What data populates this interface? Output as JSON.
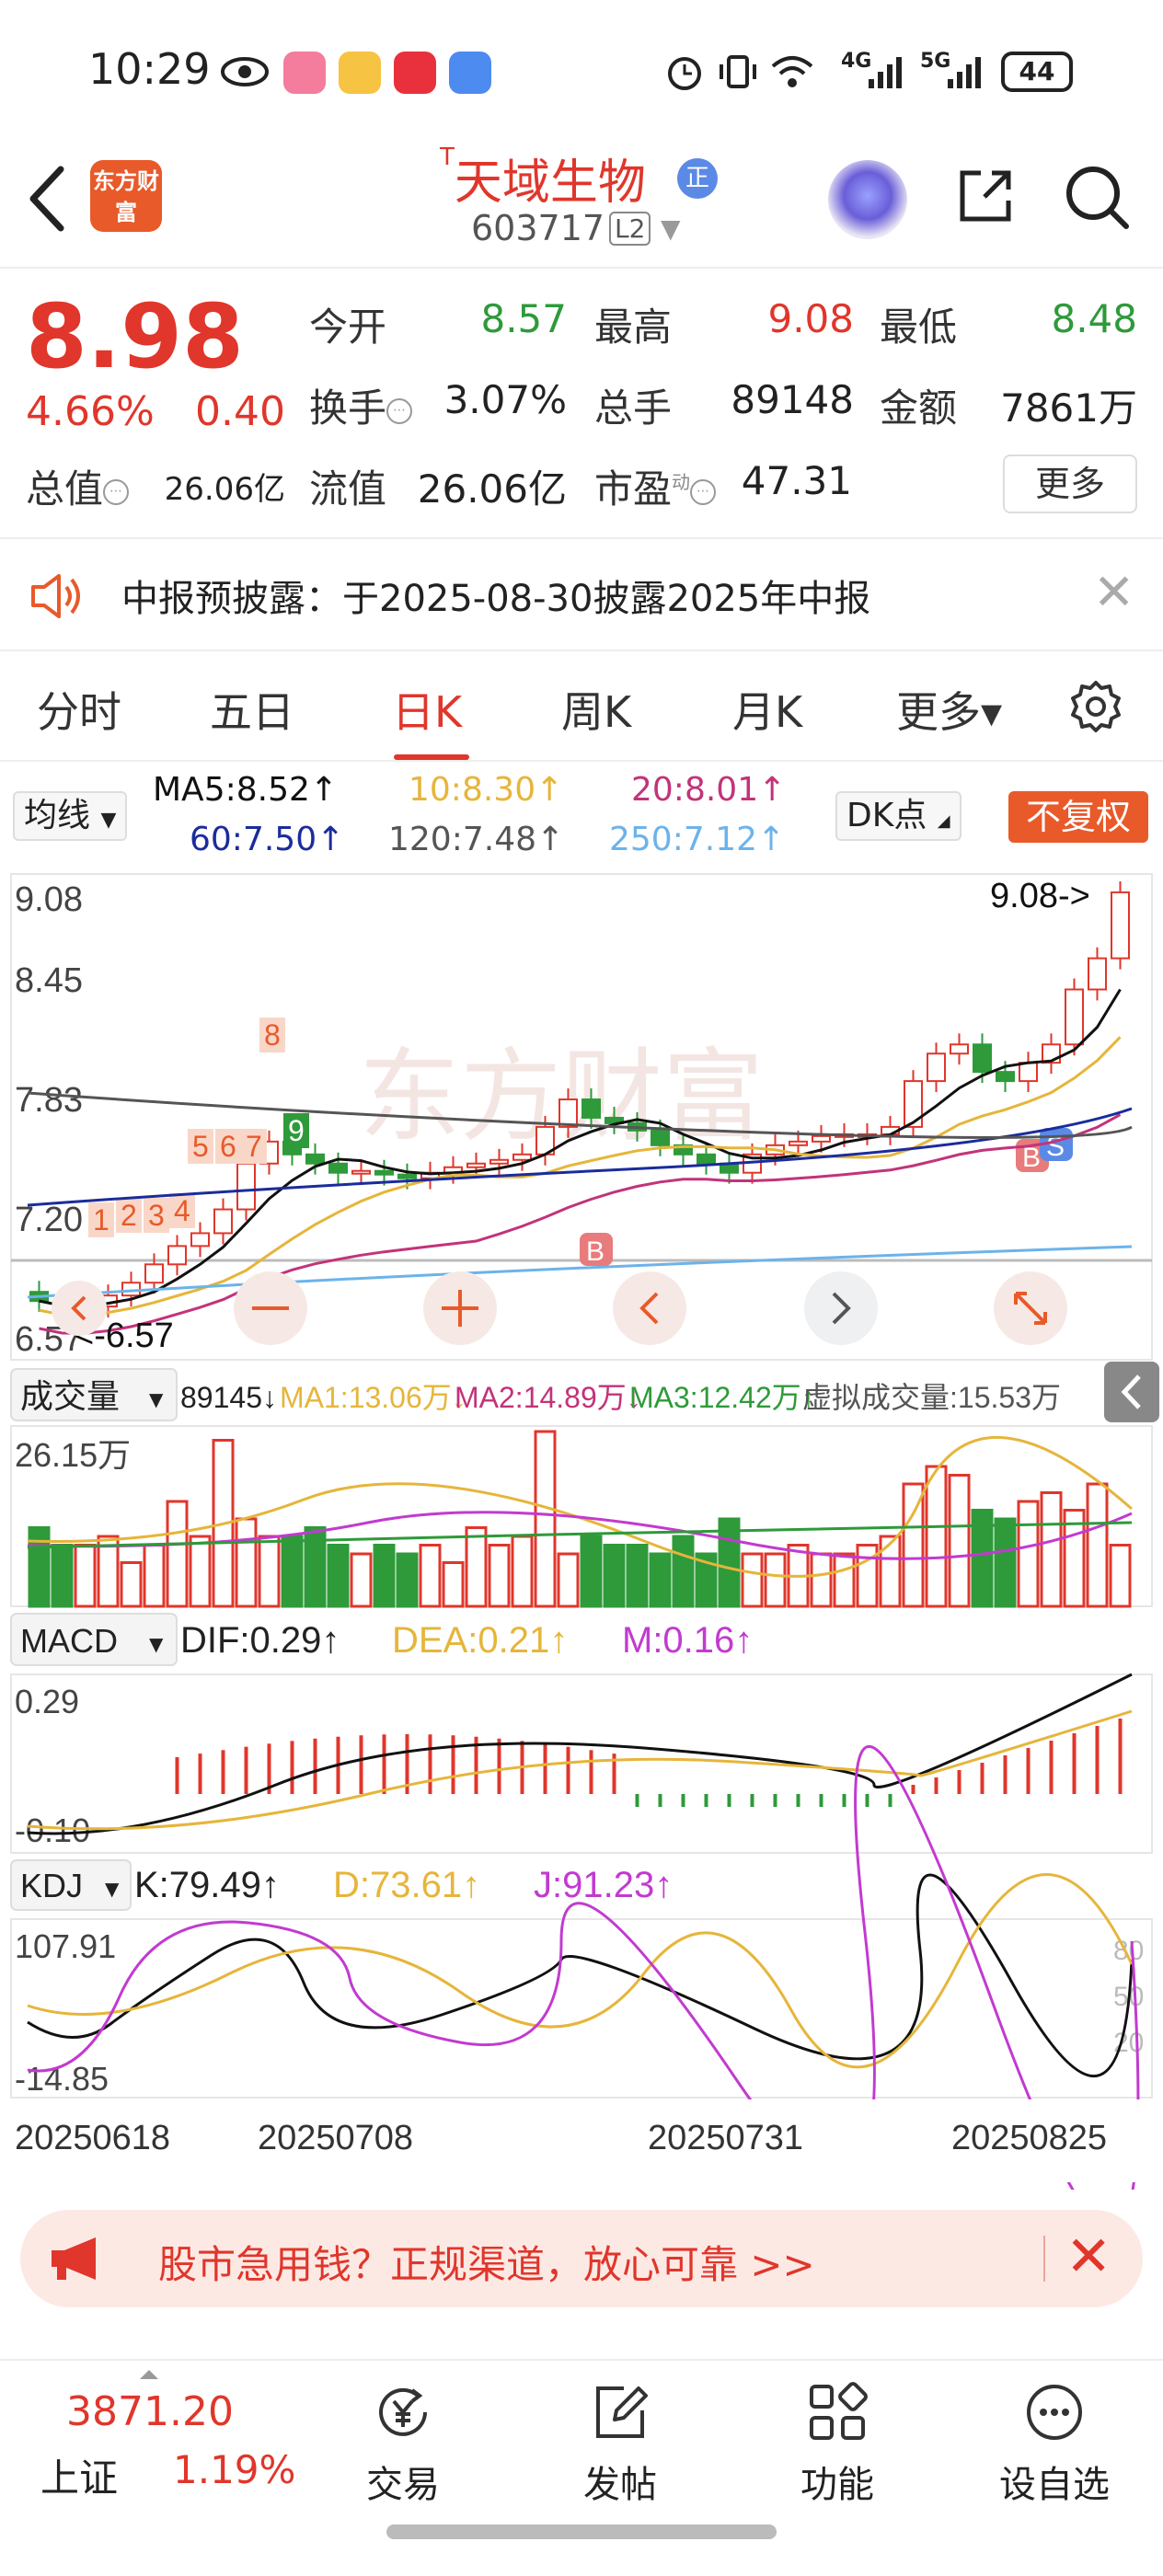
{
  "status_bar": {
    "time": "10:29",
    "network_4g": "4G",
    "network_5g": "5G",
    "battery": "44"
  },
  "header": {
    "back_icon": "chevron-left-icon",
    "brand_logo": "东方财富",
    "stock_name_prefix": "T",
    "stock_name": "天域生物",
    "badge": "正",
    "stock_code": "603717",
    "level_badge": "L2"
  },
  "quote": {
    "price": "8.98",
    "change_pct": "4.66%",
    "change": "0.40",
    "fields": [
      {
        "label": "今开",
        "value": "8.57",
        "color": "green"
      },
      {
        "label": "最高",
        "value": "9.08",
        "color": "red"
      },
      {
        "label": "最低",
        "value": "8.48",
        "color": "green"
      },
      {
        "label": "换手",
        "value": "3.07%",
        "color": "dark"
      },
      {
        "label": "总手",
        "value": "89148",
        "color": "dark"
      },
      {
        "label": "金额",
        "value": "7861万",
        "color": "dark"
      },
      {
        "label": "总值",
        "value": "26.06亿",
        "color": "dark"
      },
      {
        "label": "流值",
        "value": "26.06亿",
        "color": "dark"
      },
      {
        "label": "市盈",
        "value": "47.31",
        "color": "dark",
        "sup": "动"
      }
    ],
    "more_label": "更多"
  },
  "notice": {
    "text": "中报预披露：于2025-08-30披露2025年中报"
  },
  "tabs": [
    {
      "label": "分时"
    },
    {
      "label": "五日"
    },
    {
      "label": "日K",
      "active": true
    },
    {
      "label": "周K"
    },
    {
      "label": "月K"
    },
    {
      "label": "更多▾"
    }
  ],
  "ma_legend": {
    "selector": "均线",
    "ma5": "MA5:8.52↑",
    "ma10": "10:8.30↑",
    "ma20": "20:8.01↑",
    "ma60": "60:7.50↑",
    "ma120": "120:7.48↑",
    "ma250": "250:7.12↑",
    "dk_label": "DK点",
    "fq_label": "不复权"
  },
  "kline": {
    "y_labels": [
      "9.08",
      "8.45",
      "7.83",
      "7.20",
      "6.57"
    ],
    "high_marker": "9.08->",
    "low_marker": "<-6.57",
    "watermark": "东方财富",
    "markers": [
      "1",
      "2",
      "3",
      "4",
      "5",
      "6",
      "7",
      "8",
      "9",
      "B",
      "B",
      "S"
    ],
    "controls": [
      "minus-icon",
      "plus-icon",
      "chevron-left-icon",
      "chevron-right-icon",
      "expand-icon"
    ]
  },
  "volume": {
    "selector": "成交量",
    "value": "89145↓",
    "ma1": "MA1:13.06万↓",
    "ma2": "MA2:14.89万↓",
    "ma3": "MA3:12.42万↑",
    "virtual": "虚拟成交量:15.53万",
    "max_label": "26.15万"
  },
  "macd": {
    "selector": "MACD",
    "dif": "DIF:0.29↑",
    "dea": "DEA:0.21↑",
    "m": "M:0.16↑",
    "top_label": "0.29",
    "bottom_label": "-0.10"
  },
  "kdj": {
    "selector": "KDJ",
    "k": "K:79.49↑",
    "d": "D:73.61↑",
    "j": "J:91.23↑",
    "top_label": "107.91",
    "bottom_label": "-14.85",
    "levels": [
      "80",
      "50",
      "20"
    ]
  },
  "dates": [
    "20250618",
    "20250708",
    "20250731",
    "20250825"
  ],
  "ad_banner": {
    "text": "股市急用钱？正规渠道，放心可靠 >>"
  },
  "bottom_nav": {
    "index_value": "3871.20",
    "index_name": "上证",
    "index_pct": "1.19%",
    "items": [
      {
        "label": "交易",
        "icon": "yuan-trade-icon"
      },
      {
        "label": "发帖",
        "icon": "edit-post-icon"
      },
      {
        "label": "功能",
        "icon": "grid-function-icon"
      },
      {
        "label": "设自选",
        "icon": "more-dots-icon"
      }
    ]
  },
  "colors": {
    "red": "#e0362b",
    "green": "#2e9a3a",
    "ma5": "#111111",
    "ma10": "#e6b53a",
    "ma20": "#c2337a",
    "ma60": "#1a2c9c",
    "ma120": "#555555",
    "ma250": "#6cb3ea",
    "orange": "#e85a2a"
  }
}
